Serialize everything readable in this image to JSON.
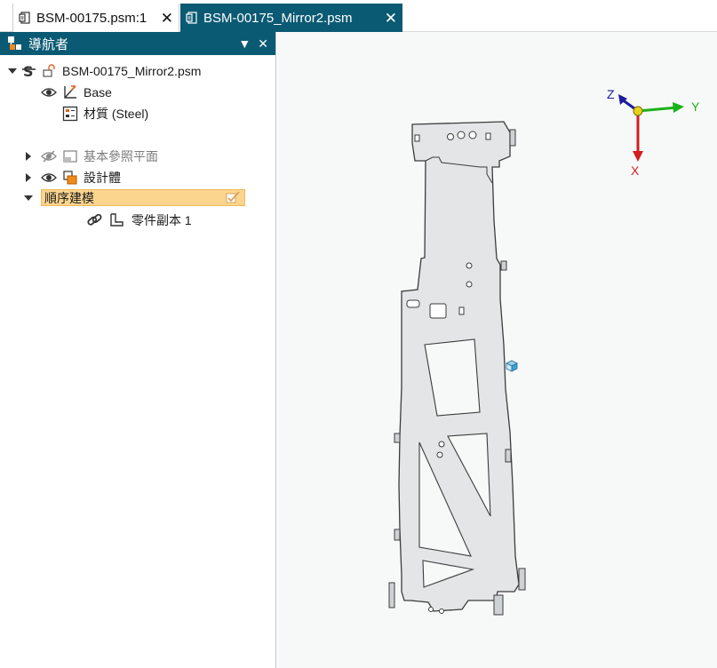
{
  "tabs": [
    {
      "label": "BSM-00175.psm:1",
      "active": false
    },
    {
      "label": "BSM-00175_Mirror2.psm",
      "active": true
    }
  ],
  "navigator": {
    "title": "導航者",
    "tree": {
      "root": "BSM-00175_Mirror2.psm",
      "base": "Base",
      "material": "材質 (Steel)",
      "ref_planes": "基本參照平面",
      "design_body": "設計體",
      "ordered_modeling": "順序建模",
      "part_copy": "零件副本 1"
    }
  },
  "viewport": {
    "axes": {
      "x": "X",
      "y": "Y",
      "z": "Z"
    },
    "colors": {
      "x_axis": "#d21f1f",
      "y_axis": "#19b319",
      "z_axis": "#1c1c9c",
      "part_fill": "#e3e5e6",
      "part_edge": "#3c3c3c"
    }
  },
  "colors": {
    "accent": "#0b5a73",
    "selection": "#fbd58e",
    "viewport_bg": "#f7f8f8"
  }
}
